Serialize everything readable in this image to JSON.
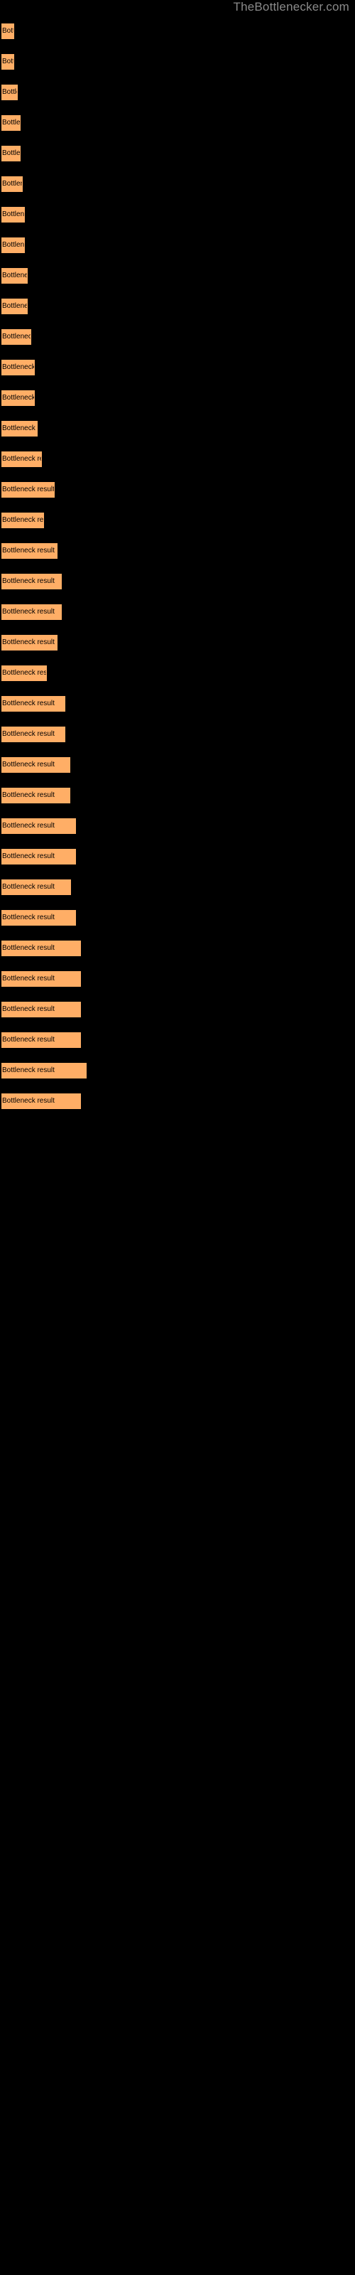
{
  "watermark": "TheBottlenecker.com",
  "chart_data": {
    "type": "bar",
    "title": "",
    "xlabel": "",
    "ylabel": "",
    "orientation": "horizontal",
    "grid": false,
    "legend": "none",
    "bar_color": "#ffae66",
    "background": "#000000",
    "label_text": "Bottleneck result",
    "categories": [
      "Bottleneck result",
      "Bottleneck result",
      "Bottleneck result",
      "Bottleneck result",
      "Bottleneck result",
      "Bottleneck result",
      "Bottleneck result",
      "Bottleneck result",
      "Bottleneck result",
      "Bottleneck result",
      "Bottleneck result",
      "Bottleneck result",
      "Bottleneck result",
      "Bottleneck result",
      "Bottleneck result",
      "Bottleneck result",
      "Bottleneck result",
      "Bottleneck result",
      "Bottleneck result",
      "Bottleneck result",
      "Bottleneck result",
      "Bottleneck result",
      "Bottleneck result",
      "Bottleneck result",
      "Bottleneck result",
      "Bottleneck result",
      "Bottleneck result",
      "Bottleneck result",
      "Bottleneck result",
      "Bottleneck result",
      "Bottleneck result",
      "Bottleneck result",
      "Bottleneck result",
      "Bottleneck result",
      "Bottleneck result",
      "Bottleneck result"
    ],
    "values": [
      18,
      18,
      23,
      27,
      27,
      30,
      33,
      33,
      37,
      37,
      42,
      47,
      47,
      51,
      57,
      75,
      60,
      79,
      85,
      85,
      79,
      64,
      90,
      90,
      97,
      97,
      105,
      105,
      98,
      105,
      112,
      112,
      112,
      112,
      120,
      112
    ],
    "xlim": [
      0,
      500
    ]
  }
}
